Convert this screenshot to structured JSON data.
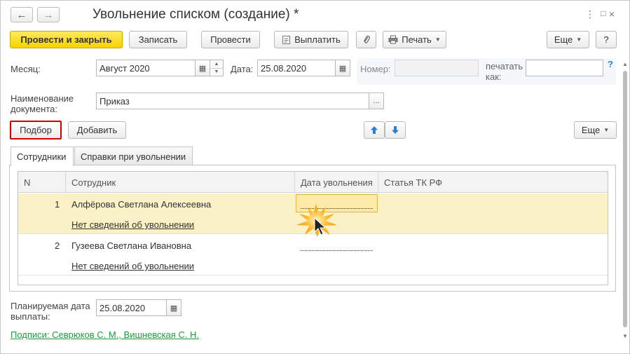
{
  "window": {
    "title": "Увольнение списком (создание) *"
  },
  "toolbar": {
    "post_close": "Провести и закрыть",
    "save": "Записать",
    "post": "Провести",
    "pay": "Выплатить",
    "print": "Печать",
    "more": "Еще",
    "help": "?"
  },
  "header_fields": {
    "month_label": "Месяц:",
    "month_value": "Август 2020",
    "date_label": "Дата:",
    "date_value": "25.08.2020",
    "number_label": "Номер:",
    "number_value": "",
    "print_as_label_1": "печатать",
    "print_as_label_2": "как:",
    "print_as_value": "",
    "help_mark": "?",
    "doc_name_label_1": "Наименование",
    "doc_name_label_2": "документа:",
    "doc_name_value": "Приказ",
    "select_button": "..."
  },
  "list_toolbar": {
    "pick": "Подбор",
    "add": "Добавить",
    "more": "Еще"
  },
  "tabs": [
    {
      "label": "Сотрудники",
      "active": true
    },
    {
      "label": "Справки при увольнении",
      "active": false
    }
  ],
  "table": {
    "columns": [
      "N",
      "Сотрудник",
      "Дата увольнения",
      "Статья ТК РФ"
    ],
    "rows": [
      {
        "n": "1",
        "employee": "Алфёрова Светлана Алексеевна",
        "note": "Нет сведений об увольнении",
        "date": "",
        "article": ""
      },
      {
        "n": "2",
        "employee": "Гузеева Светлана Ивановна",
        "note": "Нет сведений об увольнении",
        "date": "",
        "article": ""
      }
    ]
  },
  "footer": {
    "planned_label_1": "Планируемая дата",
    "planned_label_2": "выплаты:",
    "planned_value": "25.08.2020",
    "signatures": "Подписи: Севрюков С. М., Вишневская С. Н."
  },
  "icons": {
    "back": "arrow-left-icon",
    "forward": "arrow-right-icon",
    "menu": "kebab-menu-icon",
    "maximize": "square-icon",
    "close": "close-icon",
    "pay": "document-icon",
    "attach": "paperclip-icon",
    "print": "printer-icon",
    "calendar": "calendar-icon",
    "up": "arrow-up-icon",
    "down": "arrow-down-icon",
    "cursor": "pointer-cursor-icon"
  },
  "colors": {
    "primary_button": "#f5d400",
    "selected_row": "#fbf1c6",
    "highlight_outline": "#d00000",
    "link_green": "#1f9a3e",
    "arrow_blue": "#2d7fd3"
  }
}
